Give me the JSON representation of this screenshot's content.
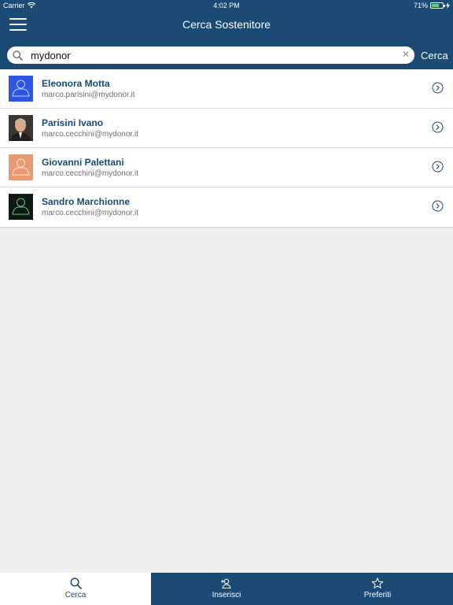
{
  "status_bar": {
    "carrier": "Carrier",
    "time": "4:02 PM",
    "battery": "71%",
    "battery_level": 0.71
  },
  "navbar": {
    "title": "Cerca Sostenitore"
  },
  "search": {
    "value": "mydonor",
    "cancel_label": "Cerca"
  },
  "results": [
    {
      "name": "Eleonora Motta",
      "email": "marco.parisini@mydonor.it",
      "avatar": "placeholder-blue"
    },
    {
      "name": "Parisini Ivano",
      "email": "marco.cecchini@mydonor.it",
      "avatar": "photo"
    },
    {
      "name": "Giovanni Palettani",
      "email": "marco.cecchini@mydonor.it",
      "avatar": "placeholder-orange"
    },
    {
      "name": "Sandro Marchionne",
      "email": "marco.cecchini@mydonor.it",
      "avatar": "placeholder-dark"
    }
  ],
  "tabs": [
    {
      "label": "Cerca",
      "icon": "search-icon",
      "active": true
    },
    {
      "label": "Inserisci",
      "icon": "add-person-icon",
      "active": false
    },
    {
      "label": "Preferiti",
      "icon": "star-icon",
      "active": false
    }
  ],
  "colors": {
    "brand": "#1b4a75",
    "background": "#efefef",
    "avatar_blue": "#2f56e0",
    "avatar_orange": "#e89a72",
    "avatar_dark": "#0c1a12"
  }
}
